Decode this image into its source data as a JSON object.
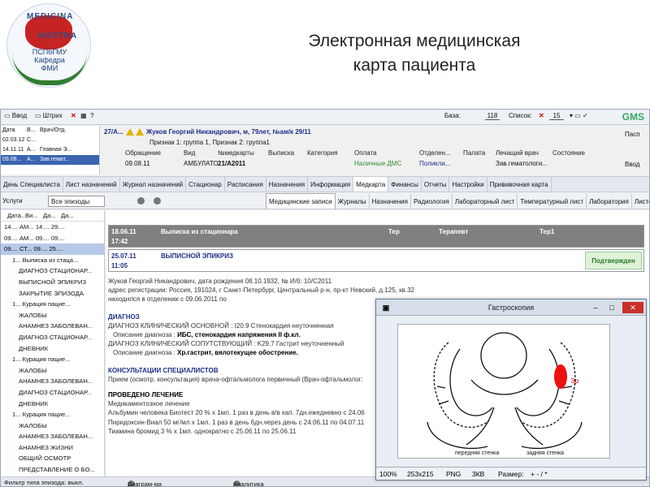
{
  "slide": {
    "title_line1": "Электронная медицинская",
    "title_line2": "карта пациента",
    "logo_text1": "MEDICINA",
    "logo_text2": "NOSTRA",
    "logo_text3": "ПСПбГМУ Кафедра ФМИ"
  },
  "toolbar": {
    "enter": "Ввод",
    "barcode": "Штрих",
    "base_label": "База:",
    "base_value": "118",
    "list_label": "Список:",
    "list_value": "15",
    "brand": "GMS"
  },
  "visits": {
    "headers": [
      "Дата",
      "В...",
      "Врач/Отд."
    ],
    "rows": [
      [
        "02.03.12",
        "С...",
        ""
      ],
      [
        "14.11.11",
        "А...",
        "Главная Э..."
      ],
      [
        "09.08...",
        "А...",
        "Зав.гемат..."
      ]
    ]
  },
  "patient": {
    "id": "27/А...",
    "name": "Жуков Георгий Никандрович, м, 79лет, №ам/к 29/11",
    "signs": "Признак 1: группа 1, Признак 2: группа1",
    "headers": [
      "Обращение",
      "Вид",
      "№медкарты",
      "Выписка",
      "Категория",
      "Оплата",
      "Отделен...",
      "Палата",
      "Лечащий врач",
      "Состояние"
    ],
    "row": [
      "09.08.11",
      "АМБУЛАТОР...",
      "21/А2011",
      "",
      "",
      "Наличные ДМС",
      "Поликли...",
      "",
      "Зав.гематологи...",
      ""
    ]
  },
  "right_side": {
    "passport": "Пасп",
    "enter": "Ввод"
  },
  "main_tabs": [
    "День Специалиста",
    "Лист назначений",
    "Журнал назначений",
    "Стационар",
    "Расписания",
    "Назначения",
    "Информация",
    "Медкарта",
    "Финансы",
    "Отчеты",
    "Настройки",
    "Прививочная карта"
  ],
  "sub": {
    "services": "Услуги",
    "all_episodes": "Все эпизоды",
    "tabs": [
      "Медицинские записи",
      "Журналы",
      "Назначения",
      "Радиология",
      "Лабораторный лист",
      "Температурный лист",
      "Лаборатория",
      "Листок нетрудоспосо..."
    ]
  },
  "tree": {
    "headers": [
      "Дата...",
      "Ви...",
      "Да...",
      "Да..."
    ],
    "rows": [
      {
        "t": "14....  АМ...  14....  29....",
        "cls": ""
      },
      {
        "t": "09....  АМ...  09....  09....",
        "cls": ""
      },
      {
        "t": "09....  СТ...  09....  25....",
        "cls": "sel"
      },
      {
        "t": "1...   Выписка из стаца...",
        "cls": "ind2"
      },
      {
        "t": "ДИАГНОЗ СТАЦИОНАР...",
        "cls": "ind"
      },
      {
        "t": "ВЫПИСНОЙ ЭПИКРИЗ",
        "cls": "ind"
      },
      {
        "t": "ЗАКРЫТИЕ ЭПИЗОДА",
        "cls": "ind"
      },
      {
        "t": "1...   Курация пацие...",
        "cls": "ind2"
      },
      {
        "t": "ЖАЛОБЫ",
        "cls": "ind"
      },
      {
        "t": "АНАМНЕЗ ЗАБОЛЕВАН...",
        "cls": "ind"
      },
      {
        "t": "ДИАГНОЗ СТАЦИОНАР...",
        "cls": "ind"
      },
      {
        "t": "ДНЕВНИК",
        "cls": "ind"
      },
      {
        "t": "1...   Курация пацие...",
        "cls": "ind2"
      },
      {
        "t": "ЖАЛОБЫ",
        "cls": "ind"
      },
      {
        "t": "АНАМНЕЗ ЗАБОЛЕВАН...",
        "cls": "ind"
      },
      {
        "t": "ДИАГНОЗ СТАЦИОНАР...",
        "cls": "ind"
      },
      {
        "t": "ДНЕВНИК",
        "cls": "ind"
      },
      {
        "t": "1...   Курация пацие...",
        "cls": "ind2"
      },
      {
        "t": "ЖАЛОБЫ",
        "cls": "ind"
      },
      {
        "t": "АНАМНЕЗ ЗАБОЛЕВАН...",
        "cls": "ind"
      },
      {
        "t": "АНАМНЕЗ ЖИЗНИ",
        "cls": "ind"
      },
      {
        "t": "ОБЩИЙ ОСМОТР",
        "cls": "ind"
      },
      {
        "t": "ПРЕДСТАВЛЕНИЕ О БО...",
        "cls": "ind"
      }
    ]
  },
  "records": {
    "r1": {
      "date": "18.06.11",
      "time": "17:42",
      "title": "Выписка из стационара",
      "c3": "Тер",
      "c4": "Терапевт",
      "c5": "Тер1"
    },
    "r2": {
      "date": "25.07.11",
      "time": "11:05",
      "title": "ВЫПИСНОЙ ЭПИКРИЗ",
      "status": "Подтвержден"
    }
  },
  "doc": {
    "p1": "Жуков Георгий Никандрович, дата рождения 08.10.1932, № И/б: 10/С2011",
    "p2": "адрес регистрации: Россия, 191024, г Санкт-Петербург, Центральный р-н, пр-кт Невский, д.125, кв.32",
    "p3": "находился в отделении с 09.06.2011 по",
    "h_diag": "ДИАГНОЗ",
    "d1": "ДИАГНОЗ КЛИНИЧЕСКИЙ ОСНОВНОЙ : I20.9 Стенокардия неуточненная",
    "d2_label": "Описание диагноза :",
    "d2_value": "ИБС, стенокардия напряжения II ф.кл.",
    "d3": "ДИАГНОЗ КЛИНИЧЕСКИЙ СОПУТСТВУЮЩИЙ : K29.7 Гастрит неуточненный",
    "d4_label": "Описание диагноза :",
    "d4_value": "Хр.гастрит, вялотекущее обострение.",
    "h_cons": "КОНСУЛЬТАЦИИ СПЕЦИАЛИСТОВ",
    "c1": "Прием (осмотр, консультация) врача-офтальмолога первичный (Врач-офтальмолог:",
    "h_treat": "ПРОВЕДЕНО ЛЕЧЕНИЕ",
    "t0": "Медикаментозное лечение",
    "t1": "Альбумин человека Биотест 20 % х 1мл. 1 раз в день в/в кап. 7дн.ежедневно с 24.06",
    "t2": "Пиридоксин-Виал 50 мг/мл х 1мл. 1 раз в день 6дн.через день с 24.06.11 по 04.07.11",
    "t3": "Тиамина бромид 3 % х 1мл. однократно с 25.06.11 по 25.06.11"
  },
  "status_bar": {
    "filter": "Фильтр типа эпизода: выкл.",
    "diagram": "Диаграм-ма",
    "analytics": "Аналитика"
  },
  "gastro": {
    "title": "Гастроскопия",
    "label_front": "передняя стенка",
    "label_back": "задняя стенка",
    "label_er": "Эр",
    "zoom": "100%",
    "size": "253x215",
    "format": "PNG",
    "filesize": "3КВ",
    "size_label": "Размер:",
    "size_value": "+ - / *"
  }
}
